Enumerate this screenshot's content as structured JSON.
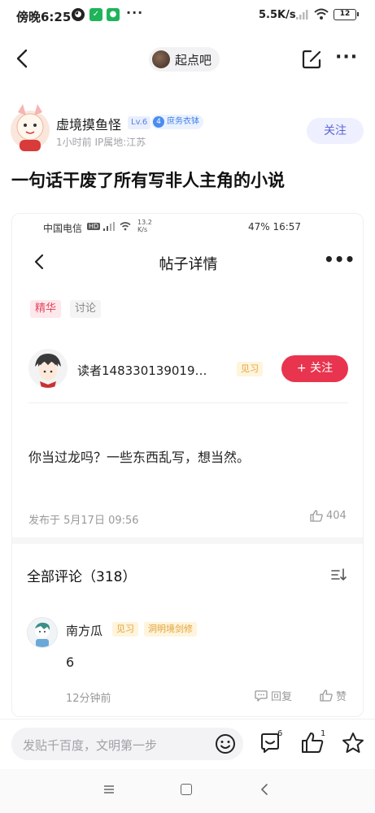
{
  "status_bar": {
    "time": "傍晚6:25",
    "net_speed": "5.5K/s",
    "battery": "12"
  },
  "nav": {
    "forum_name": "起点吧"
  },
  "post": {
    "author_name": "虚境摸鱼怪",
    "level_badge": "Lv.6",
    "title_badge_num": "4",
    "title_badge": "庶务衣钵",
    "meta": "1小时前    IP属地:江苏",
    "follow_label": "关注",
    "title": "一句话干废了所有写非人主角的小说"
  },
  "embedded": {
    "status": {
      "carrier": "中国电信",
      "speed_top": "13.2",
      "speed_unit": "K/s",
      "right": "47%    16:57"
    },
    "nav_title": "帖子详情",
    "tags": [
      "精华",
      "讨论"
    ],
    "user": {
      "name": "读者148330139019…",
      "level": "见习",
      "follow_label": "+ 关注"
    },
    "content": "你当过龙吗？一些东西乱写，想当然。",
    "date": "发布于 5月17日 09:56",
    "likes": "404",
    "comments_title": "全部评论（318）",
    "comment": {
      "name": "南方瓜",
      "level": "见习",
      "title": "洞明境剑修",
      "text": "6",
      "time": "12分钟前",
      "reply_label": "回复",
      "like_label": "赞"
    }
  },
  "bottom_bar": {
    "placeholder": "发贴千百度，文明第一步",
    "comment_count": "6",
    "like_count": "1"
  },
  "colors": {
    "accent_red": "#e8344e",
    "follow_purple": "#5b64d8",
    "badge_blue": "#4b8cf0",
    "level_gold": "#e0a43a"
  },
  "icons": [
    "qq-icon",
    "shield-icon",
    "wechat-icon",
    "signal-icon",
    "wifi-icon",
    "battery-icon",
    "back-icon",
    "edit-icon",
    "more-icon",
    "thumb-up-icon",
    "sort-icon",
    "reply-icon",
    "emoji-icon",
    "comment-icon",
    "star-icon"
  ]
}
